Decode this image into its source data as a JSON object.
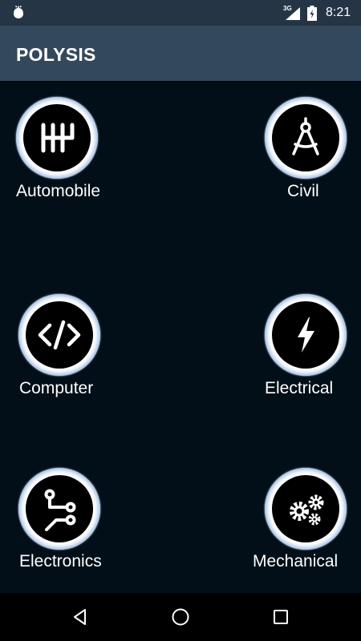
{
  "status_bar": {
    "network": "3G",
    "time": "8:21",
    "icons": [
      "app-icon",
      "signal-icon",
      "battery-charging-icon"
    ]
  },
  "toolbar": {
    "title": "POLYSIS"
  },
  "categories": [
    {
      "label": "Automobile",
      "icon": "gear-shift-icon"
    },
    {
      "label": "Civil",
      "icon": "compass-drafting-icon"
    },
    {
      "label": "Computer",
      "icon": "code-icon"
    },
    {
      "label": "Electrical",
      "icon": "lightning-bolt-icon"
    },
    {
      "label": "Electronics",
      "icon": "circuit-icon"
    },
    {
      "label": "Mechanical",
      "icon": "gears-icon"
    }
  ],
  "nav_bar": {
    "icons": [
      "back-icon",
      "home-icon",
      "recents-icon"
    ]
  },
  "colors": {
    "status_bar": "#253545",
    "toolbar": "#34485b",
    "background": "#020f18",
    "ring": "#ffffff",
    "ring_glow": "#8fb2e0"
  }
}
